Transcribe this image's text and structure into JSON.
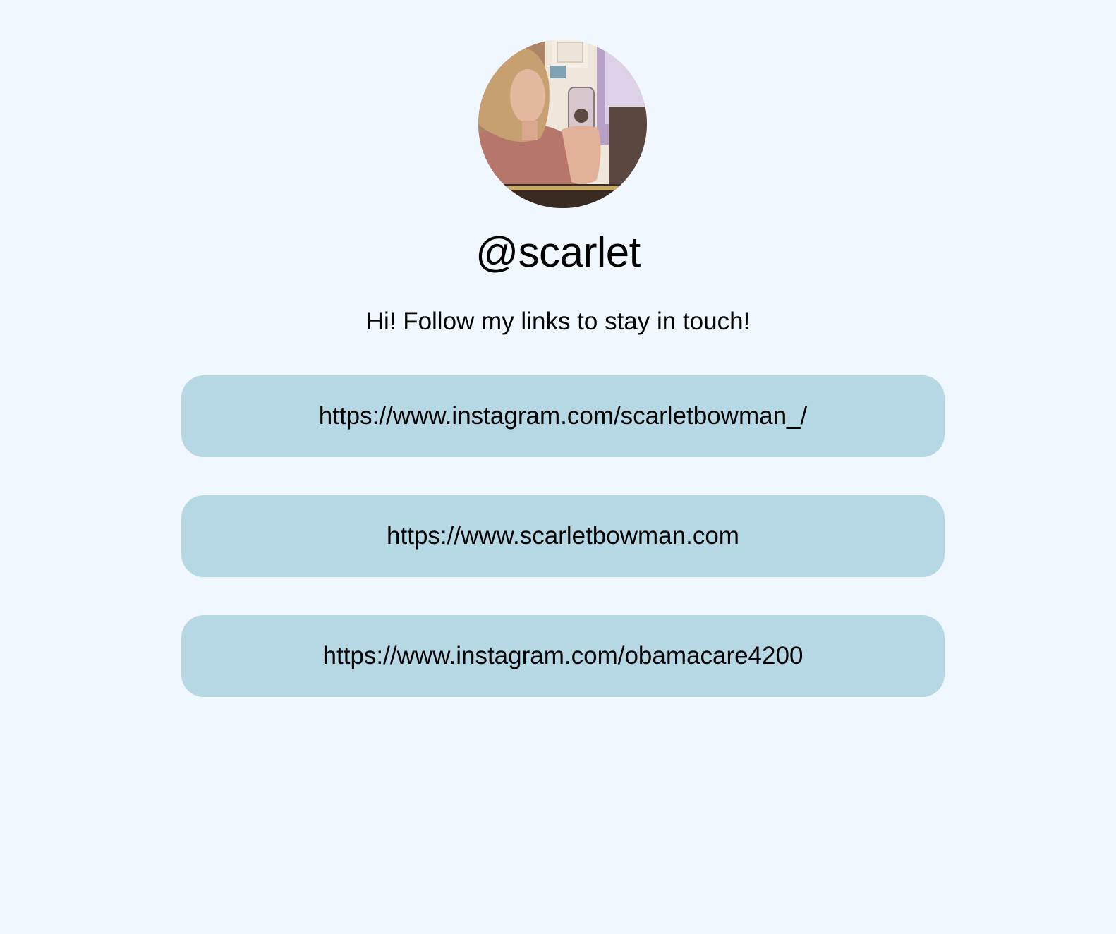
{
  "profile": {
    "handle": "@scarlet",
    "bio": "Hi! Follow my links to stay in touch!"
  },
  "links": [
    {
      "label": "https://www.instagram.com/scarletbowman_/"
    },
    {
      "label": "https://www.scarletbowman.com"
    },
    {
      "label": "https://www.instagram.com/obamacare4200"
    }
  ],
  "colors": {
    "background": "#f0f7fe",
    "link_button": "#b5d8e4",
    "text": "#000000"
  }
}
